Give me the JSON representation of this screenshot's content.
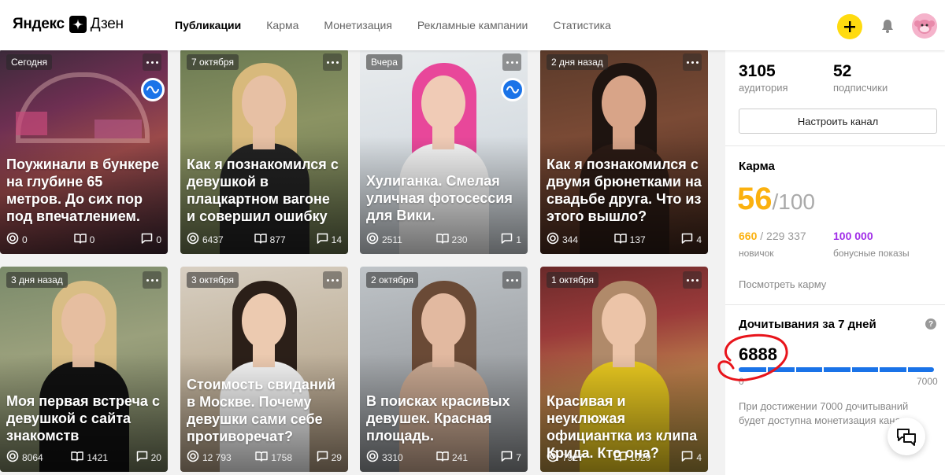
{
  "header": {
    "brand": "Яндекс",
    "product": "Дзен",
    "nav": [
      "Публикации",
      "Карма",
      "Монетизация",
      "Рекламные кампании",
      "Статистика"
    ],
    "active_nav": "Публикации",
    "icons": [
      "plus-icon",
      "bell-icon",
      "avatar"
    ],
    "colors": {
      "accent": "#ffdb0f"
    }
  },
  "cards": [
    {
      "date": "Сегодня",
      "title": "Поужинали в бункере на глубине 65 метров. До сих пор под впечатлением.",
      "views": "0",
      "reads": "0",
      "comments": "0",
      "badge": true
    },
    {
      "date": "7 октября",
      "title": "Как я познакомился с девушкой в плацкартном вагоне и совершил ошибку",
      "views": "6437",
      "reads": "877",
      "comments": "14",
      "badge": false
    },
    {
      "date": "Вчера",
      "title": "Хулиганка. Смелая уличная фотосессия для Вики.",
      "views": "2511",
      "reads": "230",
      "comments": "1",
      "badge": true
    },
    {
      "date": "2 дня назад",
      "title": "Как я познакомился с двумя брюнетками на свадьбе друга. Что из этого вышло?",
      "views": "344",
      "reads": "137",
      "comments": "4",
      "badge": false
    },
    {
      "date": "3 дня назад",
      "title": "Моя первая встреча с девушкой с сайта знакомств",
      "views": "8064",
      "reads": "1421",
      "comments": "20",
      "badge": false
    },
    {
      "date": "3 октября",
      "title": "Стоимость свиданий в Москве. Почему девушки сами себе противоречат?",
      "views": "12 793",
      "reads": "1758",
      "comments": "29",
      "badge": false
    },
    {
      "date": "2 октября",
      "title": "В поисках красивых девушек. Красная площадь.",
      "views": "3310",
      "reads": "241",
      "comments": "7",
      "badge": false
    },
    {
      "date": "1 октября",
      "title": "Красивая и неуклюжая официантка из клипа Крида. Кто она?",
      "views": "7927",
      "reads": "1029",
      "comments": "4",
      "badge": false
    }
  ],
  "sidebar": {
    "audience_value": "3105",
    "audience_label": "аудитория",
    "subscribers_value": "52",
    "subscribers_label": "подписчики",
    "configure_button": "Настроить канал",
    "karma_title": "Карма",
    "karma_value": "56",
    "karma_max": "/100",
    "karma_points": "660",
    "karma_points_total": "/ 229 337",
    "karma_level": "новичок",
    "bonus_value": "100 000",
    "bonus_label": "бонусные показы",
    "karma_link": "Посмотреть карму",
    "reads_title": "Дочитывания за 7 дней",
    "reads_value": "6888",
    "reads_progress": 0.984,
    "reads_min": "0",
    "reads_max": "7000",
    "reads_note": "При достижении 7000 дочитываний будет доступна монетизация канала",
    "colors": {
      "karma": "#fbb10f",
      "bonus": "#a12ee8",
      "progress": "#1a73e8",
      "scribble": "#e8141b"
    }
  }
}
